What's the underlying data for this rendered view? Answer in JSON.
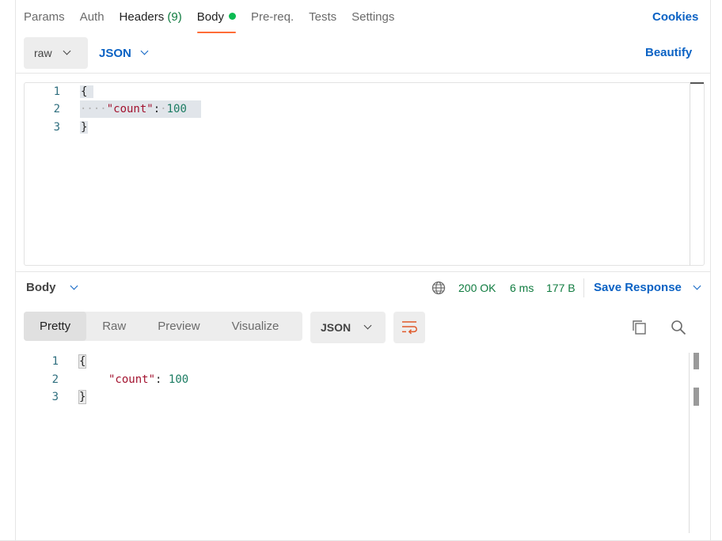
{
  "request_tabs": {
    "params": "Params",
    "auth": "Auth",
    "headers": "Headers",
    "headers_count": "(9)",
    "body": "Body",
    "prereq": "Pre-req.",
    "tests": "Tests",
    "settings": "Settings"
  },
  "cookies_label": "Cookies",
  "body_mode": "raw",
  "body_language": "JSON",
  "beautify_label": "Beautify",
  "request_editor": {
    "line_numbers": [
      "1",
      "2",
      "3"
    ],
    "open_brace": "{",
    "indent": "····",
    "key": "\"count\"",
    "colon": ":",
    "value": "100",
    "close_brace": "}"
  },
  "response": {
    "section_label": "Body",
    "status": "200 OK",
    "time": "6 ms",
    "size": "177 B",
    "save_label": "Save Response",
    "view_tabs": [
      "Pretty",
      "Raw",
      "Preview",
      "Visualize"
    ],
    "active_view": "Pretty",
    "format": "JSON",
    "line_numbers": [
      "1",
      "2",
      "3"
    ],
    "open_brace": "{",
    "key": "\"count\"",
    "colon": ":",
    "value": "100",
    "close_brace": "}"
  },
  "icons": {
    "globe": "globe-icon",
    "wrap": "wrap-lines-icon",
    "copy": "copy-icon",
    "search": "search-icon",
    "chevron": "chevron-down-icon"
  },
  "colors": {
    "accent_blue": "#0b62c4",
    "tab_underline": "#ff6c37",
    "status_green": "#0f7b3f",
    "dot_green": "#0cbb52",
    "json_key": "#a3132f",
    "json_number": "#1b7c62"
  }
}
